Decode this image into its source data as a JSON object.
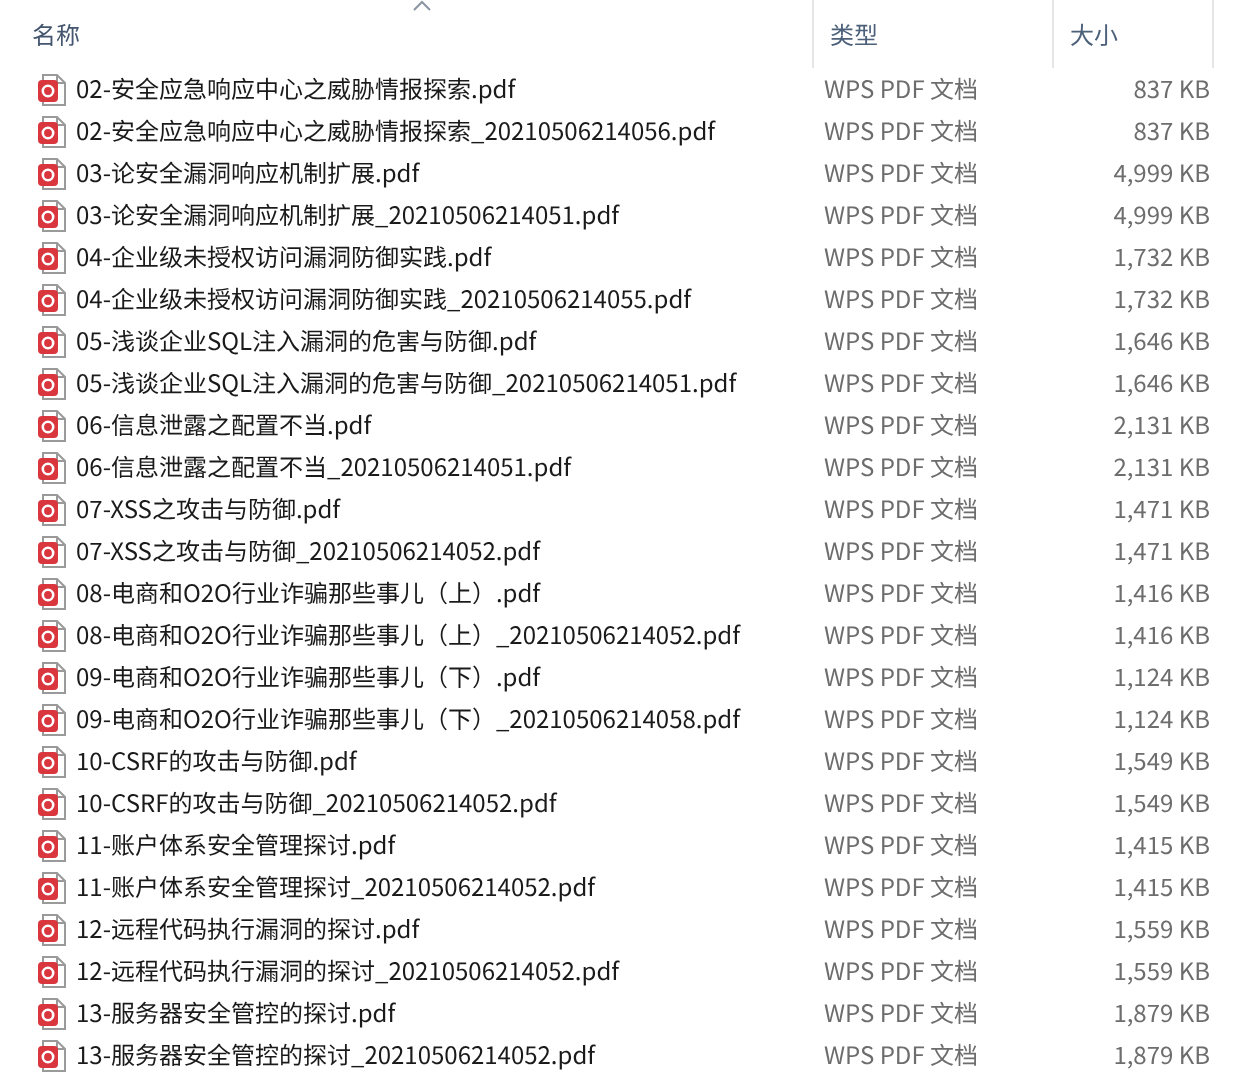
{
  "columns": [
    {
      "label": "名称",
      "kind": "name",
      "sorted": true
    },
    {
      "label": "类型",
      "kind": "type",
      "sorted": false
    },
    {
      "label": "大小",
      "kind": "size",
      "sorted": false
    }
  ],
  "rows": [
    {
      "name": "02-安全应急响应中心之威胁情报探索.pdf",
      "type": "WPS PDF 文档",
      "size": "837 KB"
    },
    {
      "name": "02-安全应急响应中心之威胁情报探索_20210506214056.pdf",
      "type": "WPS PDF 文档",
      "size": "837 KB"
    },
    {
      "name": "03-论安全漏洞响应机制扩展.pdf",
      "type": "WPS PDF 文档",
      "size": "4,999 KB"
    },
    {
      "name": "03-论安全漏洞响应机制扩展_20210506214051.pdf",
      "type": "WPS PDF 文档",
      "size": "4,999 KB"
    },
    {
      "name": "04-企业级未授权访问漏洞防御实践.pdf",
      "type": "WPS PDF 文档",
      "size": "1,732 KB"
    },
    {
      "name": "04-企业级未授权访问漏洞防御实践_20210506214055.pdf",
      "type": "WPS PDF 文档",
      "size": "1,732 KB"
    },
    {
      "name": "05-浅谈企业SQL注入漏洞的危害与防御.pdf",
      "type": "WPS PDF 文档",
      "size": "1,646 KB"
    },
    {
      "name": "05-浅谈企业SQL注入漏洞的危害与防御_20210506214051.pdf",
      "type": "WPS PDF 文档",
      "size": "1,646 KB"
    },
    {
      "name": "06-信息泄露之配置不当.pdf",
      "type": "WPS PDF 文档",
      "size": "2,131 KB"
    },
    {
      "name": "06-信息泄露之配置不当_20210506214051.pdf",
      "type": "WPS PDF 文档",
      "size": "2,131 KB"
    },
    {
      "name": "07-XSS之攻击与防御.pdf",
      "type": "WPS PDF 文档",
      "size": "1,471 KB"
    },
    {
      "name": "07-XSS之攻击与防御_20210506214052.pdf",
      "type": "WPS PDF 文档",
      "size": "1,471 KB"
    },
    {
      "name": "08-电商和O2O行业诈骗那些事儿（上）.pdf",
      "type": "WPS PDF 文档",
      "size": "1,416 KB"
    },
    {
      "name": "08-电商和O2O行业诈骗那些事儿（上）_20210506214052.pdf",
      "type": "WPS PDF 文档",
      "size": "1,416 KB"
    },
    {
      "name": "09-电商和O2O行业诈骗那些事儿（下）.pdf",
      "type": "WPS PDF 文档",
      "size": "1,124 KB"
    },
    {
      "name": "09-电商和O2O行业诈骗那些事儿（下）_20210506214058.pdf",
      "type": "WPS PDF 文档",
      "size": "1,124 KB"
    },
    {
      "name": "10-CSRF的攻击与防御.pdf",
      "type": "WPS PDF 文档",
      "size": "1,549 KB"
    },
    {
      "name": "10-CSRF的攻击与防御_20210506214052.pdf",
      "type": "WPS PDF 文档",
      "size": "1,549 KB"
    },
    {
      "name": "11-账户体系安全管理探讨.pdf",
      "type": "WPS PDF 文档",
      "size": "1,415 KB"
    },
    {
      "name": "11-账户体系安全管理探讨_20210506214052.pdf",
      "type": "WPS PDF 文档",
      "size": "1,415 KB"
    },
    {
      "name": "12-远程代码执行漏洞的探讨.pdf",
      "type": "WPS PDF 文档",
      "size": "1,559 KB"
    },
    {
      "name": "12-远程代码执行漏洞的探讨_20210506214052.pdf",
      "type": "WPS PDF 文档",
      "size": "1,559 KB"
    },
    {
      "name": "13-服务器安全管控的探讨.pdf",
      "type": "WPS PDF 文档",
      "size": "1,879 KB"
    },
    {
      "name": "13-服务器安全管控的探讨_20210506214052.pdf",
      "type": "WPS PDF 文档",
      "size": "1,879 KB"
    }
  ]
}
